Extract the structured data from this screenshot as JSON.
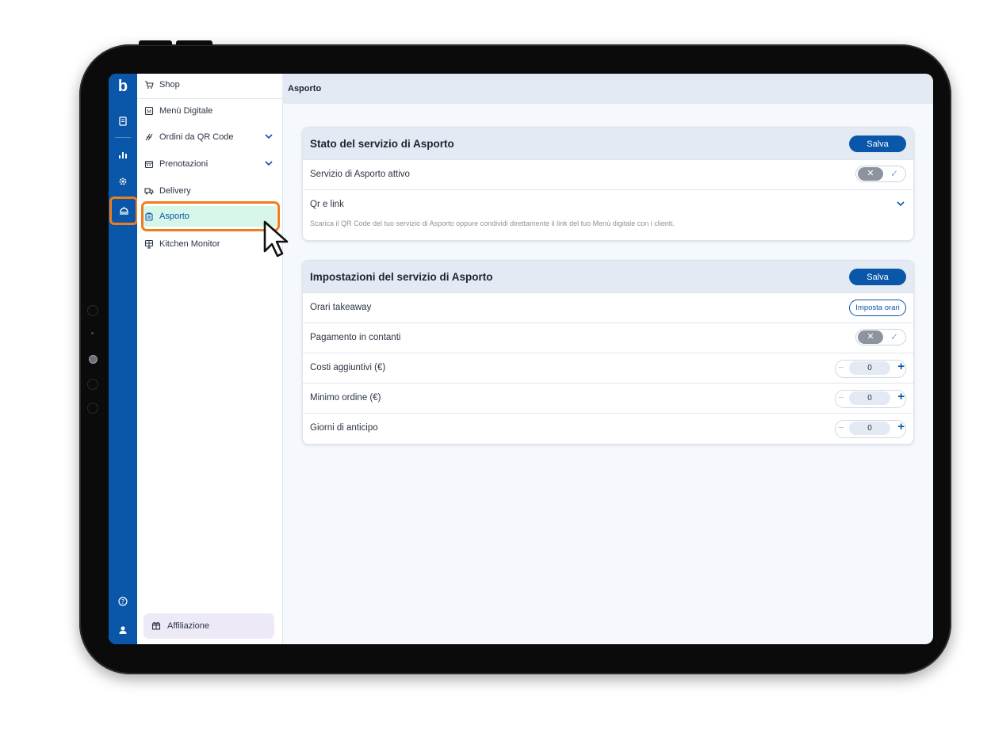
{
  "colors": {
    "brand_blue": "#0a56a8",
    "highlight_orange": "#f07c1c",
    "active_bg": "#d7f6ea",
    "header_bg": "#e3eaf3"
  },
  "rail": {
    "logo": "b",
    "icons": [
      "receipt-icon",
      "chart-icon",
      "settings-icon",
      "takeaway-icon",
      "help-icon",
      "user-icon"
    ]
  },
  "menu": {
    "items": [
      {
        "label": "Shop",
        "icon": "cart-icon"
      },
      {
        "label": "Menù Digitale",
        "icon": "menu-book-icon"
      },
      {
        "label": "Ordini da QR Code",
        "icon": "qr-order-icon",
        "expandable": true
      },
      {
        "label": "Prenotazioni",
        "icon": "calendar-icon",
        "expandable": true
      },
      {
        "label": "Delivery",
        "icon": "delivery-icon"
      },
      {
        "label": "Asporto",
        "icon": "bag-icon",
        "active": true
      },
      {
        "label": "Kitchen Monitor",
        "icon": "monitor-icon"
      }
    ],
    "affiliazione": "Affiliazione"
  },
  "topbar": {
    "title": "Asporto"
  },
  "stato_card": {
    "title": "Stato del servizio di Asporto",
    "save_label": "Salva",
    "servizio_attivo": {
      "label": "Servizio di Asporto attivo",
      "enabled": false
    },
    "qr": {
      "label": "Qr e link",
      "description": "Scarica il QR Code del tuo servizio di Asporto oppure condividi direttamente il link del tuo Menù digitale con i clienti."
    }
  },
  "impostazioni_card": {
    "title": "Impostazioni del servizio di Asporto",
    "save_label": "Salva",
    "orari": {
      "label": "Orari takeaway",
      "button_label": "Imposta orari"
    },
    "pagamento": {
      "label": "Pagamento in contanti",
      "enabled": false
    },
    "costi": {
      "label": "Costi aggiuntivi (€)",
      "value": "0"
    },
    "minimo": {
      "label": "Minimo ordine (€)",
      "value": "0"
    },
    "giorni": {
      "label": "Giorni di anticipo",
      "value": "0"
    }
  },
  "toggle_glyphs": {
    "off": "✕",
    "on": "✓"
  },
  "stepper_glyphs": {
    "minus": "−",
    "plus": "+"
  }
}
